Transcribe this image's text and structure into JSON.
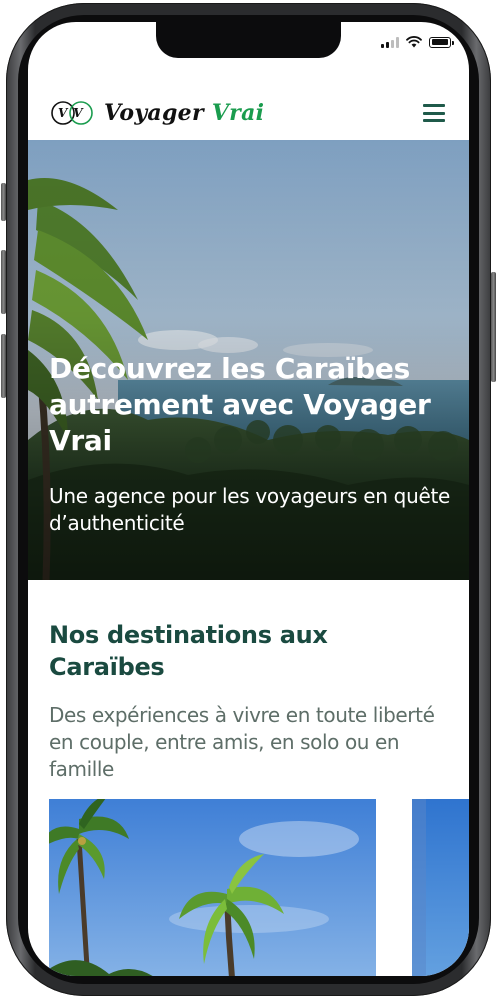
{
  "brand": {
    "monogram": "VV",
    "name_part1": "Voyager",
    "name_part2": "Vrai",
    "accent_color": "#1a9c4e",
    "heading_color": "#1a4a40"
  },
  "header": {
    "menu_icon": "hamburger-menu-icon"
  },
  "status_bar": {
    "icons": [
      "cellular-signal-icon",
      "wifi-icon",
      "battery-icon"
    ]
  },
  "hero": {
    "title": "Découvrez les Caraïbes autrement avec Voyager Vrai",
    "subtitle": "Une agence pour les voyageurs en quête d’authenticité"
  },
  "destinations": {
    "title": "Nos destinations aux Caraïbes",
    "description": "Des expériences à vivre en toute liberté en couple, entre amis, en solo ou en famille"
  }
}
